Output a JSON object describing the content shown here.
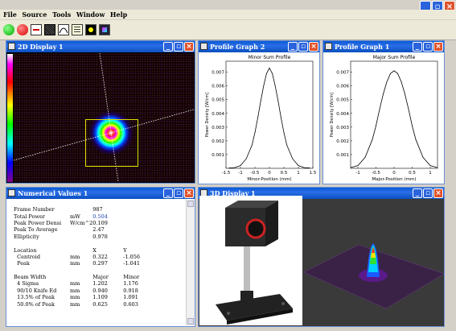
{
  "app": {
    "menu": [
      "File",
      "Source",
      "Tools",
      "Window",
      "Help"
    ],
    "window_controls": [
      "minimize",
      "maximize",
      "close"
    ]
  },
  "toolbar": {
    "buttons": [
      "green-circle",
      "red-circle",
      "laser-line",
      "noise-square",
      "profile-graph",
      "numeric-values",
      "display-2d",
      "display-3d"
    ]
  },
  "display2d": {
    "title": "2D Display 1"
  },
  "profile2": {
    "title": "Profile Graph 2",
    "chart_data": {
      "type": "line",
      "title": "Minor Sum Profile",
      "xlabel": "Minor-Position (mm)",
      "ylabel": "Power Density [W/cm]",
      "xlim": [
        -1.5,
        1.5
      ],
      "ylim": [
        0,
        0.0078
      ],
      "xticks": [
        "-1.5",
        "-1",
        "-0.5",
        "0",
        "0.5",
        "1",
        "1.5"
      ],
      "yticks": [
        "0.001",
        "0.002",
        "0.003",
        "0.004",
        "0.005",
        "0.006",
        "0.007"
      ],
      "x": [
        -1.4,
        -1.2,
        -1.0,
        -0.8,
        -0.6,
        -0.5,
        -0.4,
        -0.3,
        -0.2,
        -0.1,
        0,
        0.1,
        0.2,
        0.3,
        0.4,
        0.5,
        0.6,
        0.8,
        1.0,
        1.2,
        1.4
      ],
      "y": [
        2e-05,
        5e-05,
        0.0002,
        0.0007,
        0.0017,
        0.0026,
        0.0037,
        0.0049,
        0.006,
        0.0069,
        0.0073,
        0.0069,
        0.006,
        0.0049,
        0.0037,
        0.0026,
        0.0017,
        0.0007,
        0.0002,
        5e-05,
        2e-05
      ]
    }
  },
  "profile1": {
    "title": "Profile Graph 1",
    "chart_data": {
      "type": "line",
      "title": "Major Sum Profile",
      "xlabel": "Major-Position (mm)",
      "ylabel": "Power Density [W/cm]",
      "xlim": [
        -1.2,
        1.2
      ],
      "ylim": [
        0,
        0.0078
      ],
      "xticks": [
        "-1",
        "-0.5",
        "0",
        "0.5",
        "1"
      ],
      "yticks": [
        "0.001",
        "0.002",
        "0.003",
        "0.004",
        "0.005",
        "0.006",
        "0.007"
      ],
      "x": [
        -1.2,
        -1.0,
        -0.8,
        -0.6,
        -0.5,
        -0.4,
        -0.3,
        -0.2,
        -0.1,
        0,
        0.1,
        0.2,
        0.3,
        0.4,
        0.5,
        0.6,
        0.8,
        1.0,
        1.2
      ],
      "y": [
        5e-05,
        0.0002,
        0.0008,
        0.0021,
        0.0031,
        0.0043,
        0.0054,
        0.0063,
        0.0069,
        0.0071,
        0.0069,
        0.0063,
        0.0054,
        0.0043,
        0.0031,
        0.0021,
        0.0008,
        0.0002,
        5e-05
      ]
    }
  },
  "numeric": {
    "title": "Numerical Values 1",
    "rows": [
      {
        "label": "Frame Number",
        "unit": "",
        "a": "987",
        "b": "",
        "blue": false
      },
      {
        "label": "Total Power",
        "unit": "mW",
        "a": "0.504",
        "b": "",
        "blue": true
      },
      {
        "label": "Peak Power Densi",
        "unit": "W/cm^2",
        "a": "0.109",
        "b": "",
        "blue": false
      },
      {
        "label": "Peak To Average",
        "unit": "",
        "a": "2.47",
        "b": "",
        "blue": false
      },
      {
        "label": "Ellipticity",
        "unit": "",
        "a": "0.978",
        "b": "",
        "blue": false
      },
      {
        "label": "",
        "unit": "",
        "a": "",
        "b": "",
        "blue": false
      },
      {
        "label": "Location",
        "unit": "",
        "a": "X",
        "b": "Y",
        "blue": false
      },
      {
        "label": "  Centroid",
        "unit": "mm",
        "a": "0.322",
        "b": "-1.056",
        "blue": false
      },
      {
        "label": "  Peak",
        "unit": "mm",
        "a": "0.297",
        "b": "-1.041",
        "blue": false
      },
      {
        "label": "",
        "unit": "",
        "a": "",
        "b": "",
        "blue": false
      },
      {
        "label": "Beam Width",
        "unit": "",
        "a": "Major",
        "b": "Minor",
        "blue": false
      },
      {
        "label": "  4 Sigma",
        "unit": "mm",
        "a": "1.202",
        "b": "1.176",
        "blue": false
      },
      {
        "label": "  90/10 Knife Ed",
        "unit": "mm",
        "a": "0.940",
        "b": "0.918",
        "blue": false
      },
      {
        "label": "  13.5% of Peak",
        "unit": "mm",
        "a": "1.109",
        "b": "1.091",
        "blue": false
      },
      {
        "label": "  50.0% of Peak",
        "unit": "mm",
        "a": "0.625",
        "b": "0.603",
        "blue": false
      }
    ]
  },
  "display3d": {
    "title": "3D Display 1"
  }
}
